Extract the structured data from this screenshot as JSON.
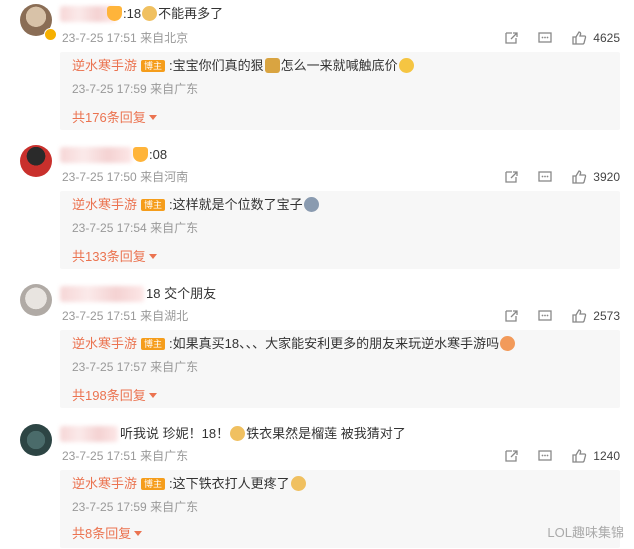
{
  "comments": [
    {
      "handle_suffix": ":18",
      "text": "不能再多了",
      "date": "23-7-25 17:51",
      "location": "来自北京",
      "likes": "4625",
      "reply": {
        "name": "逆水寒手游",
        "tag": "博主",
        "text": ":宝宝你们真的狠",
        "text2": "怎么一来就喊触底价",
        "date": "23-7-25 17:59",
        "location": "来自广东"
      },
      "more": "共176条回复"
    },
    {
      "handle_suffix": ":08",
      "text": "",
      "date": "23-7-25 17:50",
      "location": "来自河南",
      "likes": "3920",
      "reply": {
        "name": "逆水寒手游",
        "tag": "博主",
        "text": ":这样就是个位数了宝子",
        "text2": "",
        "date": "23-7-25 17:54",
        "location": "来自广东"
      },
      "more": "共133条回复"
    },
    {
      "handle_suffix": "18 交个朋友",
      "text": "",
      "date": "23-7-25 17:51",
      "location": "来自湖北",
      "likes": "2573",
      "reply": {
        "name": "逆水寒手游",
        "tag": "博主",
        "text": ":如果真买18、、、大家能安利更多的朋友来玩逆水寒手游吗",
        "text2": "",
        "date": "23-7-25 17:57",
        "location": "来自广东"
      },
      "more": "共198条回复"
    },
    {
      "handle_suffix": "听我说 珍妮！18！",
      "text": "铁衣果然是榴莲 被我猜对了",
      "date": "23-7-25 17:51",
      "location": "来自广东",
      "likes": "1240",
      "reply": {
        "name": "逆水寒手游",
        "tag": "博主",
        "text": ":这下铁衣打人更疼了",
        "text2": "",
        "date": "23-7-25 17:59",
        "location": "来自广东"
      },
      "more": "共8条回复"
    }
  ],
  "watermark": "LOL趣味集锦",
  "colors": {
    "accent": "#eb7350",
    "tag": "#f59d1b",
    "meta": "#999999"
  }
}
